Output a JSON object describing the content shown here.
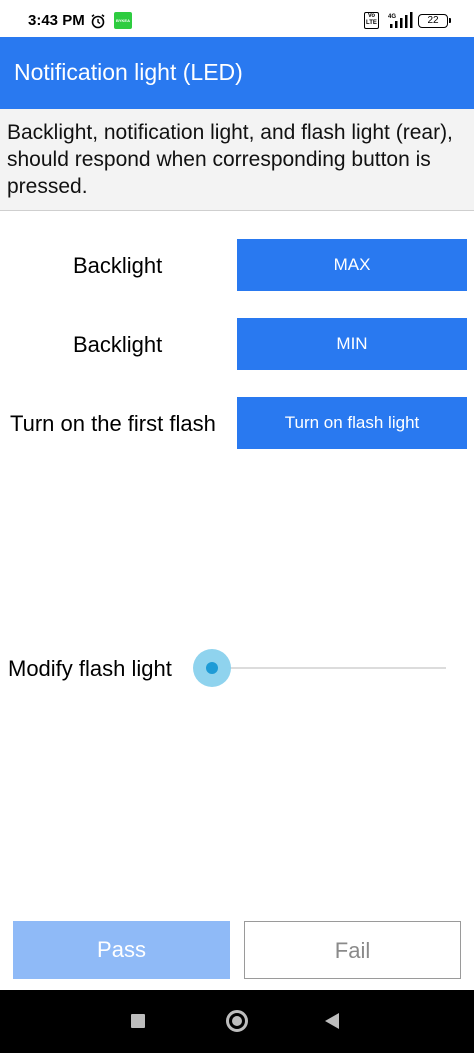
{
  "status_bar": {
    "time": "3:43 PM",
    "app_badge": "BYKEA",
    "volte": "Vo LTE",
    "network": "4G",
    "battery": "22"
  },
  "app_bar": {
    "title": "Notification light (LED)"
  },
  "description": "Backlight, notification light, and flash light (rear), should respond when corresponding button is pressed.",
  "rows": [
    {
      "label": "Backlight",
      "button": "MAX"
    },
    {
      "label": "Backlight",
      "button": "MIN"
    },
    {
      "label": "Turn on the first flash",
      "button": "Turn on flash light"
    }
  ],
  "slider": {
    "label": "Modify flash light",
    "value": 0
  },
  "actions": {
    "pass": "Pass",
    "fail": "Fail"
  },
  "colors": {
    "primary": "#2979f0",
    "pass_disabled": "#8fbaf7",
    "slider_thumb": "#1e9bd6"
  },
  "icons": {
    "alarm": "alarm-clock-icon",
    "signal": "cell-signal-icon",
    "battery": "battery-icon",
    "nav_recent": "square-icon",
    "nav_home": "circle-icon",
    "nav_back": "triangle-back-icon"
  }
}
